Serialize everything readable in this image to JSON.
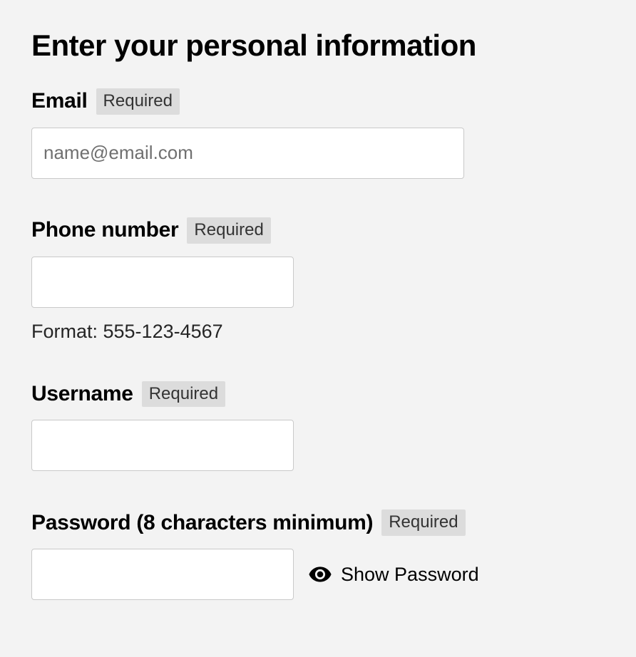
{
  "heading": "Enter your personal information",
  "required_label": "Required",
  "fields": {
    "email": {
      "label": "Email",
      "placeholder": "name@email.com",
      "value": ""
    },
    "phone": {
      "label": "Phone number",
      "value": "",
      "helper": "Format: 555-123-4567"
    },
    "username": {
      "label": "Username",
      "value": ""
    },
    "password": {
      "label": "Password (8 characters minimum)",
      "value": "",
      "show_toggle": "Show Password"
    }
  }
}
